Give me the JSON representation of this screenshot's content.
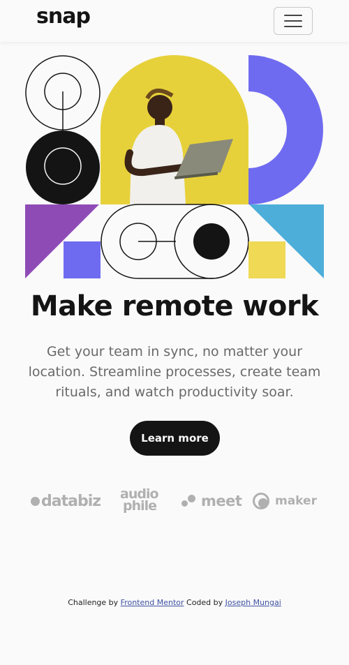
{
  "header": {
    "logo": "snap",
    "menu_icon": "hamburger-menu-icon"
  },
  "hero": {
    "title": "Make remote work",
    "description": "Get your team in sync, no matter your location. Streamline processes, create team rituals, and watch productivity soar.",
    "cta_label": "Learn more",
    "colors": {
      "yellow": "#e7d13a",
      "purple": "#6f6bf0",
      "violet": "#8e4bb6",
      "sky": "#4daed9",
      "pale_yellow": "#efd955",
      "black": "#141414"
    }
  },
  "clients": {
    "databiz": "databiz",
    "audiophile_top": "audio",
    "audiophile_bottom": "phile",
    "meet": "meet",
    "maker": "maker"
  },
  "footer": {
    "challenge_prefix": "Challenge by",
    "challenge_link": "Frontend Mentor",
    "coded_prefix": "Coded by",
    "author_link": "Joseph Mungai"
  }
}
